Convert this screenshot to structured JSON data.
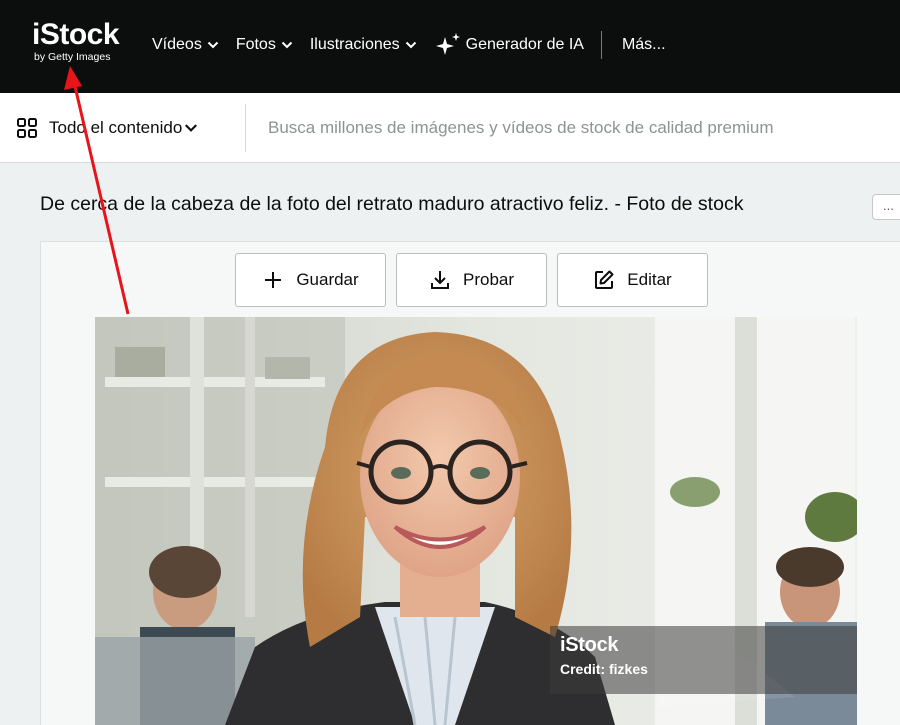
{
  "brand": {
    "logo_main": "iStock",
    "logo_sub": "by Getty Images"
  },
  "nav": {
    "items": [
      {
        "label": "Vídeos",
        "has_dropdown": true
      },
      {
        "label": "Fotos",
        "has_dropdown": true
      },
      {
        "label": "Ilustraciones",
        "has_dropdown": true
      }
    ],
    "ai_generator": "Generador de IA",
    "more": "Más..."
  },
  "search": {
    "filter_label": "Todo el contenido",
    "placeholder": "Busca millones de imágenes y vídeos de stock de calidad premium",
    "value": ""
  },
  "page": {
    "title": "De cerca de la cabeza de la foto del retrato maduro atractivo feliz. - Foto de stock",
    "more_button": "..."
  },
  "actions": {
    "save": "Guardar",
    "try": "Probar",
    "edit": "Editar"
  },
  "photo": {
    "watermark_logo": "iStock",
    "credit": "Credit: fizkes"
  },
  "icons": {
    "chevron": "chevron-down-icon",
    "sparkle": "sparkle-icon",
    "grid": "grid-icon",
    "save": "plus-icon",
    "try": "download-icon",
    "edit": "edit-icon"
  },
  "colors": {
    "nav_bg": "#0c0d0d",
    "page_bg": "#eef1f1",
    "annotation": "#e8141a"
  }
}
